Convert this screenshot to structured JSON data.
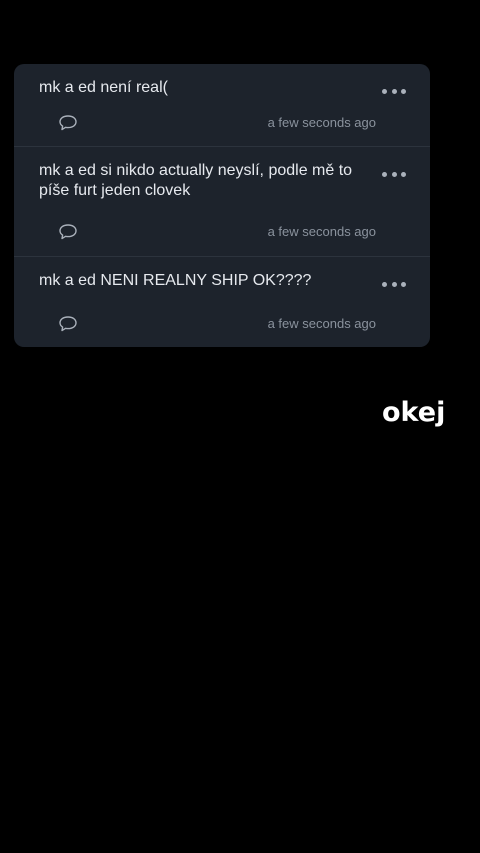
{
  "comments": [
    {
      "text": "mk a ed není real(",
      "timestamp": "a few seconds ago",
      "reply_icon": "speech-bubble-icon",
      "more_icon": "ellipsis-icon"
    },
    {
      "text": "mk a ed si nikdo actually neyslí, podle mě to píše furt jeden clovek",
      "timestamp": "a few seconds ago",
      "reply_icon": "speech-bubble-icon",
      "more_icon": "ellipsis-icon"
    },
    {
      "text": "mk a ed NENI REALNY SHIP OK????",
      "timestamp": "a few seconds ago",
      "reply_icon": "speech-bubble-icon",
      "more_icon": "ellipsis-icon"
    }
  ],
  "sticker": {
    "text": "okej"
  },
  "colors": {
    "background": "#000000",
    "card": "#1d232c",
    "text": "#e6e9ee",
    "muted": "#8a929d"
  }
}
